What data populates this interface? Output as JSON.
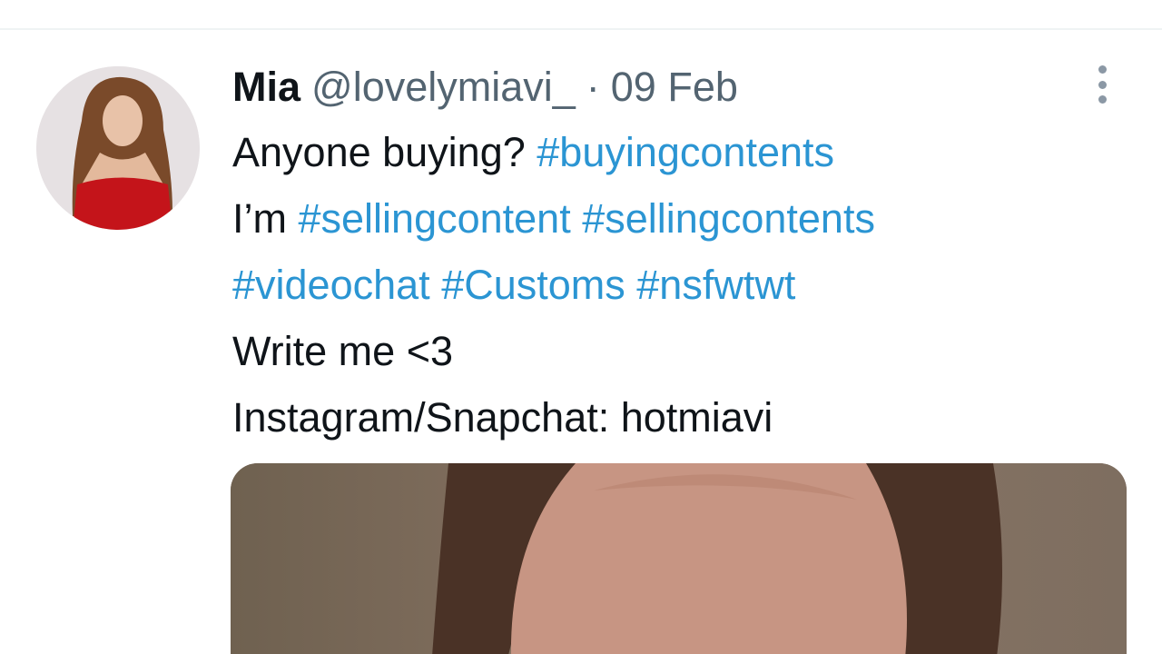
{
  "tweet": {
    "display_name": "Mia",
    "handle": "@lovelymiavi_",
    "separator": "·",
    "date": "09 Feb",
    "more_icon": "more-vertical-icon",
    "lines": [
      [
        {
          "text": "Anyone buying? ",
          "hashtag": false
        },
        {
          "text": "#buyingcontents",
          "hashtag": true
        }
      ],
      [
        {
          "text": "I’m ",
          "hashtag": false
        },
        {
          "text": "#sellingcontent",
          "hashtag": true
        },
        {
          "text": " ",
          "hashtag": false
        },
        {
          "text": "#sellingcontents",
          "hashtag": true
        }
      ],
      [
        {
          "text": "#videochat",
          "hashtag": true
        },
        {
          "text": " ",
          "hashtag": false
        },
        {
          "text": "#Customs",
          "hashtag": true
        },
        {
          "text": " ",
          "hashtag": false
        },
        {
          "text": "#nsfwtwt",
          "hashtag": true
        }
      ],
      [
        {
          "text": "Write me <3",
          "hashtag": false
        }
      ],
      [
        {
          "text": "Instagram/Snapchat: hotmiavi",
          "hashtag": false
        }
      ]
    ]
  },
  "colors": {
    "name": "#0f1419",
    "secondary": "#536471",
    "hashtag": "#2b95d3",
    "divider": "#eff3f4"
  }
}
